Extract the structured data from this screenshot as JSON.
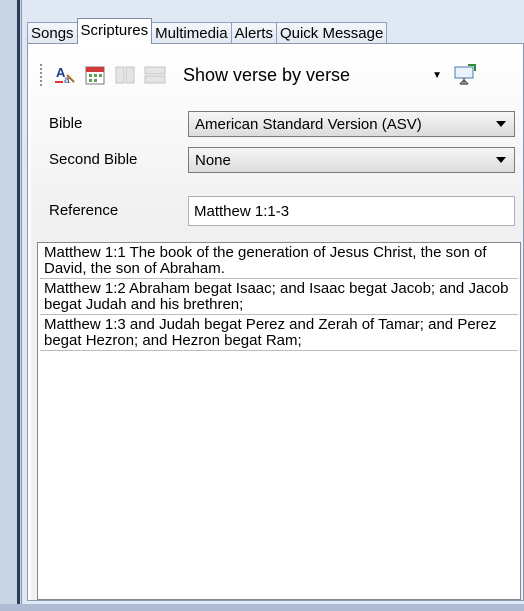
{
  "tabs": [
    {
      "label": "Songs",
      "active": false
    },
    {
      "label": "Scriptures",
      "active": true
    },
    {
      "label": "Multimedia",
      "active": false
    },
    {
      "label": "Alerts",
      "active": false
    },
    {
      "label": "Quick Message",
      "active": false
    }
  ],
  "toolbar": {
    "view_mode": "Show verse by verse",
    "icons": [
      "font-format-icon",
      "calendar-icon",
      "two-columns-icon",
      "rows-icon",
      "present-screen-icon"
    ]
  },
  "form": {
    "bible_label": "Bible",
    "bible_value": "American Standard Version (ASV)",
    "second_bible_label": "Second Bible",
    "second_bible_value": "None",
    "reference_label": "Reference",
    "reference_value": "Matthew 1:1-3"
  },
  "verses": [
    "Matthew 1:1 The book of the generation of Jesus Christ, the son of David, the son of Abraham.",
    "Matthew 1:2 Abraham begat Isaac; and Isaac begat Jacob; and Jacob begat Judah and his brethren;",
    "Matthew 1:3 and Judah begat Perez and Zerah of Tamar; and Perez begat Hezron; and Hezron begat Ram;"
  ],
  "colors": {
    "window_edge": "#2b3a56",
    "tab_border": "#8da2c0",
    "panel_border": "#8a99b2"
  }
}
